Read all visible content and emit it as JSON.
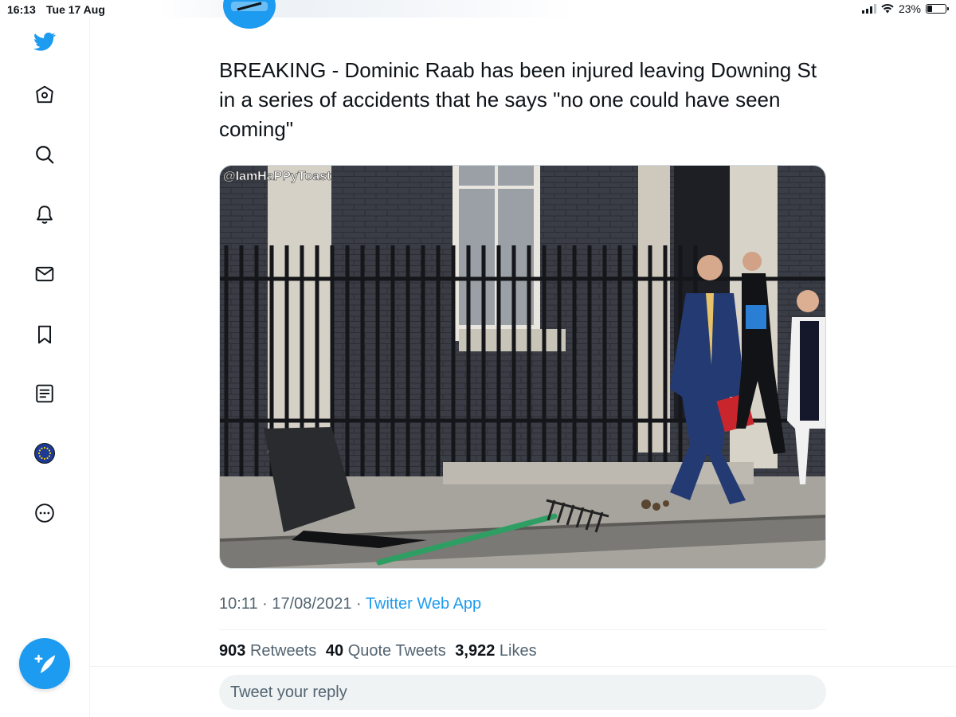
{
  "status_bar": {
    "time": "16:13",
    "date": "Tue 17 Aug",
    "battery_percent": "23%",
    "battery_level": 0.23
  },
  "sidebar": {
    "items": [
      {
        "name": "twitter-logo-icon"
      },
      {
        "name": "home-icon"
      },
      {
        "name": "explore-icon"
      },
      {
        "name": "notifications-icon"
      },
      {
        "name": "messages-icon"
      },
      {
        "name": "bookmarks-icon"
      },
      {
        "name": "lists-icon"
      },
      {
        "name": "profile-icon"
      },
      {
        "name": "more-icon"
      }
    ],
    "compose_icon": "compose-tweet-icon"
  },
  "tweet": {
    "text": "BREAKING - Dominic Raab has been injured leaving Downing St in a series of accidents that he says \"no one could have seen coming\"",
    "media": {
      "watermark": "@IamHaPPyToast"
    },
    "time": "10:11",
    "separator": "·",
    "date": "17/08/2021",
    "source": "Twitter Web App",
    "stats": {
      "retweets_count": "903",
      "retweets_label": "Retweets",
      "quotes_count": "40",
      "quotes_label": "Quote Tweets",
      "likes_count": "3,922",
      "likes_label": "Likes"
    }
  },
  "reply": {
    "placeholder": "Tweet your reply"
  },
  "colors": {
    "accent": "#1d9bf0",
    "text": "#0f1419",
    "secondary": "#536471",
    "border": "#eff3f4"
  }
}
